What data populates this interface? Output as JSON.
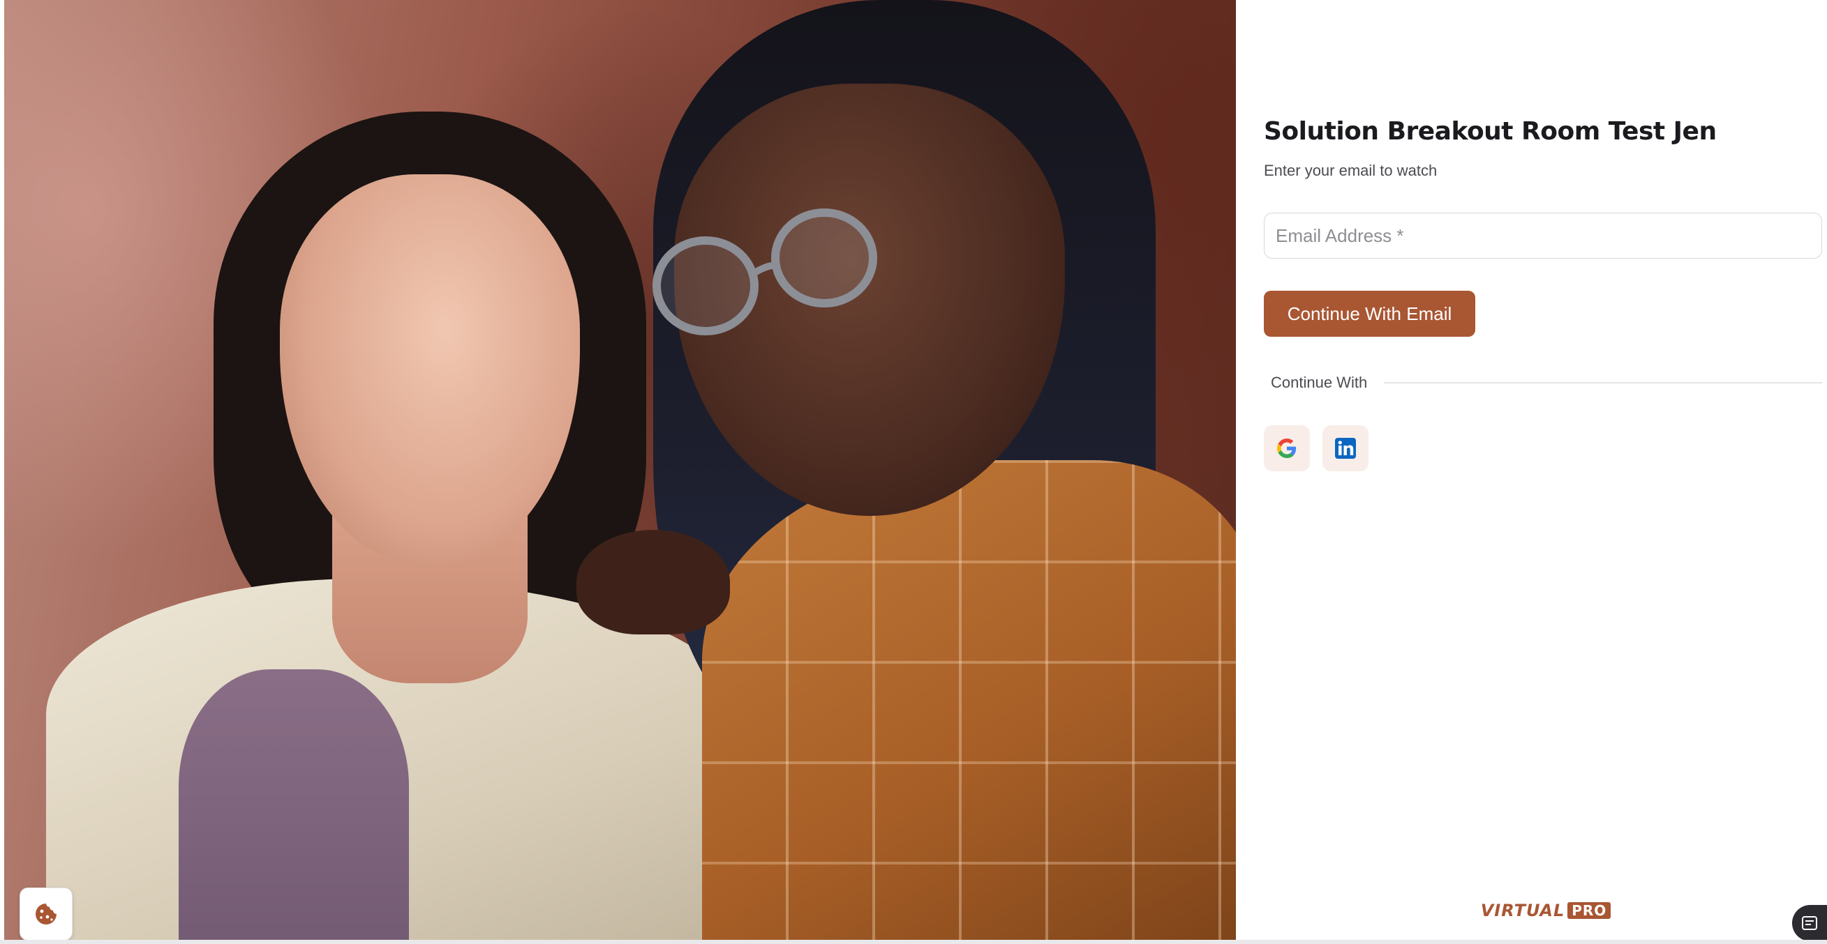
{
  "hero": {
    "image": "two-women-portrait-photo"
  },
  "form": {
    "title": "Solution Breakout Room Test Jen",
    "subtitle": "Enter your email to watch",
    "email": {
      "placeholder": "Email Address *",
      "value": ""
    },
    "submit_label": "Continue With Email",
    "divider_label": "Continue With",
    "social": [
      {
        "provider": "Google",
        "icon": "google-icon"
      },
      {
        "provider": "LinkedIn",
        "icon": "linkedin-icon"
      }
    ]
  },
  "brand": {
    "word": "VIRTUAL",
    "box": "PRO"
  },
  "widgets": {
    "cookie_icon": "cookie-icon",
    "assist_icon": "accessibility-icon"
  },
  "colors": {
    "accent": "#a95633",
    "social_bg": "#f8ede8",
    "title": "#1b1b1f",
    "muted_text": "#4b4b52"
  }
}
